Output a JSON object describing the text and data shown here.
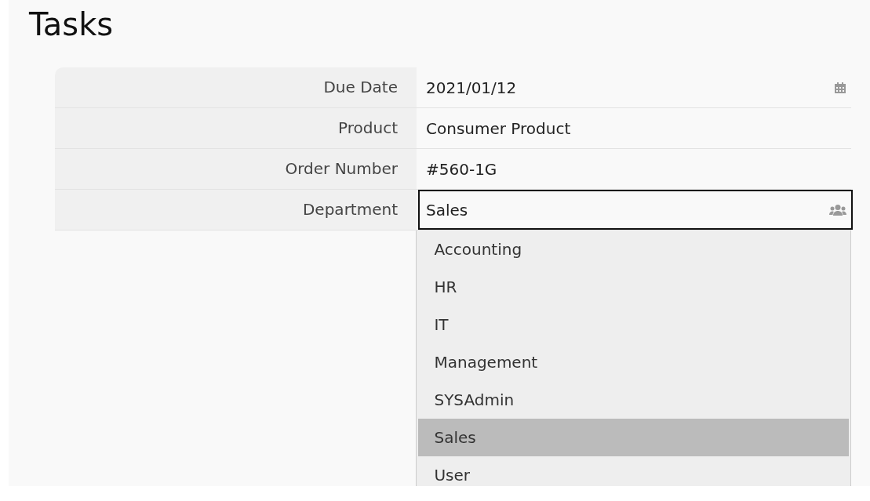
{
  "title": "Tasks",
  "fields": [
    {
      "label": "Due Date",
      "value": "2021/01/12",
      "kind": "date",
      "focused": false
    },
    {
      "label": "Product",
      "value": "Consumer Product",
      "kind": "text",
      "focused": false
    },
    {
      "label": "Order Number",
      "value": "#560-1G",
      "kind": "text",
      "focused": false
    },
    {
      "label": "Department",
      "value": "Sales",
      "kind": "group",
      "focused": true
    }
  ],
  "dropdown": {
    "options": [
      {
        "label": "Accounting",
        "selected": false
      },
      {
        "label": "HR",
        "selected": false
      },
      {
        "label": "IT",
        "selected": false
      },
      {
        "label": "Management",
        "selected": false
      },
      {
        "label": "SYSAdmin",
        "selected": false
      },
      {
        "label": "Sales",
        "selected": true
      },
      {
        "label": "User",
        "selected": false
      }
    ]
  }
}
